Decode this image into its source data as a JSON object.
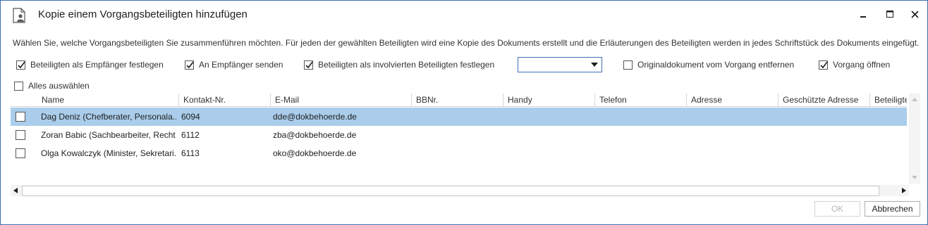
{
  "window": {
    "title": "Kopie einem Vorgangsbeteiligten hinzufügen"
  },
  "description": "Wählen Sie, welche Vorgangsbeteiligten Sie zusammenführen möchten. Für jeden der gewählten Beteiligten wird eine Kopie des Dokuments erstellt und die Erläuterungen des Beteiligten werden in jedes Schriftstück des Dokuments eingefügt.",
  "options": {
    "set_recipient": {
      "label": "Beteiligten als Empfänger festlegen",
      "checked": true
    },
    "send_to_recipient": {
      "label": "An Empfänger senden",
      "checked": true
    },
    "set_involved": {
      "label": "Beteiligten als involvierten Beteiligten festlegen",
      "checked": true
    },
    "involved_type": {
      "value": ""
    },
    "remove_original": {
      "label": "Originaldokument vom Vorgang entfernen",
      "checked": false
    },
    "open_case": {
      "label": "Vorgang öffnen",
      "checked": true
    },
    "select_all": {
      "label": "Alles auswählen",
      "checked": false
    }
  },
  "table": {
    "columns": [
      "Name",
      "Kontakt-Nr.",
      "E-Mail",
      "BBNr.",
      "Handy",
      "Telefon",
      "Adresse",
      "Geschützte Adresse",
      "Beteiligte"
    ],
    "rows": [
      {
        "name": "Dag Deniz (Chefberater, Personala...",
        "contact": "6094",
        "email": "dde@dokbehoerde.de",
        "selected": true
      },
      {
        "name": "Zoran Babic (Sachbearbeiter, Recht...",
        "contact": "6112",
        "email": "zba@dokbehoerde.de",
        "selected": false
      },
      {
        "name": "Olga Kowalczyk (Minister, Sekretari...",
        "contact": "6113",
        "email": "oko@dokbehoerde.de",
        "selected": false
      }
    ]
  },
  "buttons": {
    "ok": "OK",
    "cancel": "Abbrechen"
  },
  "colors": {
    "accent": "#3d6fb4",
    "selection": "#aacdeb"
  }
}
